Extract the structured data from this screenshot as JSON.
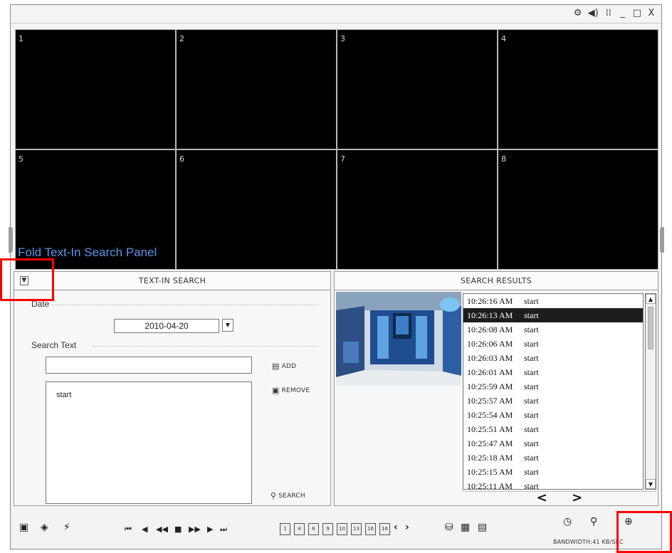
{
  "window_controls": [
    "⚙",
    "◀)",
    "⁞⁞",
    "_",
    "□",
    "X"
  ],
  "channels": [
    "1",
    "2",
    "3",
    "4",
    "5",
    "6",
    "7",
    "8"
  ],
  "tooltip": "Fold Text-In Search Panel",
  "text_in_search": {
    "title": "TEXT-IN SEARCH",
    "fold_icon": "fold-icon",
    "date_label": "Date",
    "date_value": "2010-04-20",
    "search_text_label": "Search Text",
    "search_text_value": "",
    "texts": [
      "start"
    ],
    "add_label": "ADD",
    "remove_label": "REMOVE",
    "search_label": "SEARCH"
  },
  "search_results": {
    "title": "SEARCH RESULTS",
    "selected_index": 1,
    "rows": [
      {
        "time": "10:26:16 AM",
        "text": "start"
      },
      {
        "time": "10:26:13 AM",
        "text": "start"
      },
      {
        "time": "10:26:08 AM",
        "text": "start"
      },
      {
        "time": "10:26:06 AM",
        "text": "start"
      },
      {
        "time": "10:26:03 AM",
        "text": "start"
      },
      {
        "time": "10:26:01 AM",
        "text": "start"
      },
      {
        "time": "10:25:59 AM",
        "text": "start"
      },
      {
        "time": "10:25:57 AM",
        "text": "start"
      },
      {
        "time": "10:25:54 AM",
        "text": "start"
      },
      {
        "time": "10:25:51 AM",
        "text": "start"
      },
      {
        "time": "10:25:47 AM",
        "text": "start"
      },
      {
        "time": "10:25:18 AM",
        "text": "start"
      },
      {
        "time": "10:25:15 AM",
        "text": "start"
      },
      {
        "time": "10:25:11 AM",
        "text": "start"
      }
    ],
    "prev": "<",
    "next": ">"
  },
  "toolbar": {
    "playback": [
      "⏮",
      "◀",
      "◀◀",
      "■",
      "▶▶",
      "▶",
      "⏭"
    ],
    "layouts": [
      "1",
      "4",
      "6",
      "9",
      "10",
      "13",
      "16",
      "16"
    ],
    "bandwidth": "BANDWIDTH:41 KB/SEC"
  }
}
